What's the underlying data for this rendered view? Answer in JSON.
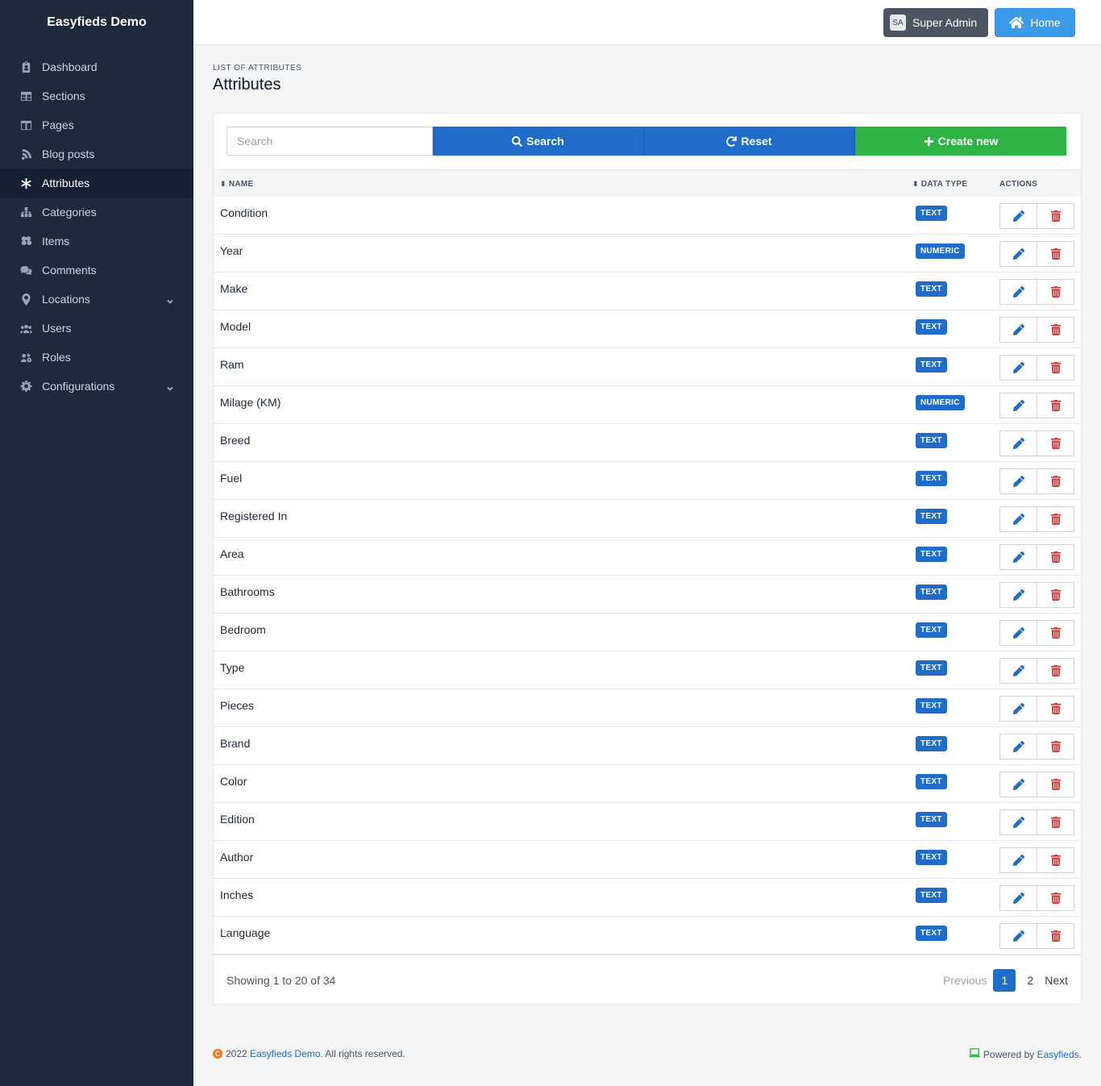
{
  "app": {
    "brand": "Easyfieds Demo"
  },
  "sidebar": {
    "items": [
      {
        "label": "Dashboard",
        "icon": "clipboard-icon"
      },
      {
        "label": "Sections",
        "icon": "table-icon"
      },
      {
        "label": "Pages",
        "icon": "columns-icon"
      },
      {
        "label": "Blog posts",
        "icon": "blog-icon"
      },
      {
        "label": "Attributes",
        "icon": "asterisk-icon",
        "active": true
      },
      {
        "label": "Categories",
        "icon": "sitemap-icon"
      },
      {
        "label": "Items",
        "icon": "cubes-icon"
      },
      {
        "label": "Comments",
        "icon": "comments-icon"
      },
      {
        "label": "Locations",
        "icon": "map-marker-icon",
        "expandable": true
      },
      {
        "label": "Users",
        "icon": "users-icon"
      },
      {
        "label": "Roles",
        "icon": "users-cog-icon"
      },
      {
        "label": "Configurations",
        "icon": "cog-icon",
        "expandable": true
      }
    ]
  },
  "header": {
    "user_initials": "SA",
    "user_label": "Super Admin",
    "home_label": "Home"
  },
  "page": {
    "pre_title": "LIST OF ATTRIBUTES",
    "title": "Attributes"
  },
  "toolbar": {
    "search_placeholder": "Search",
    "search_label": "Search",
    "reset_label": "Reset",
    "create_label": "Create new"
  },
  "table": {
    "columns": {
      "name": "NAME",
      "data_type": "DATA TYPE",
      "actions": "ACTIONS"
    },
    "rows": [
      {
        "name": "Condition",
        "type": "TEXT"
      },
      {
        "name": "Year",
        "type": "NUMERIC"
      },
      {
        "name": "Make",
        "type": "TEXT"
      },
      {
        "name": "Model",
        "type": "TEXT"
      },
      {
        "name": "Ram",
        "type": "TEXT"
      },
      {
        "name": "Milage (KM)",
        "type": "NUMERIC"
      },
      {
        "name": "Breed",
        "type": "TEXT"
      },
      {
        "name": "Fuel",
        "type": "TEXT"
      },
      {
        "name": "Registered In",
        "type": "TEXT"
      },
      {
        "name": "Area",
        "type": "TEXT"
      },
      {
        "name": "Bathrooms",
        "type": "TEXT"
      },
      {
        "name": "Bedroom",
        "type": "TEXT"
      },
      {
        "name": "Type",
        "type": "TEXT"
      },
      {
        "name": "Pieces",
        "type": "TEXT"
      },
      {
        "name": "Brand",
        "type": "TEXT"
      },
      {
        "name": "Color",
        "type": "TEXT"
      },
      {
        "name": "Edition",
        "type": "TEXT"
      },
      {
        "name": "Author",
        "type": "TEXT"
      },
      {
        "name": "Inches",
        "type": "TEXT"
      },
      {
        "name": "Language",
        "type": "TEXT"
      }
    ]
  },
  "pagination": {
    "showing": "Showing 1 to 20 of 34",
    "previous": "Previous",
    "current": "1",
    "page_2": "2",
    "next": "Next"
  },
  "footer": {
    "copyright_icon": "C",
    "year": "2022",
    "brand_link": "Easyfieds Demo",
    "rights": ". All rights reserved.",
    "powered": "Powered by",
    "powered_link": "Easyfieds",
    "powered_end": "."
  },
  "colors": {
    "sidebar_bg": "#1e293b",
    "primary": "#1f6dc9",
    "success": "#2fb344",
    "danger": "#d63939",
    "home": "#3b9ae9"
  }
}
